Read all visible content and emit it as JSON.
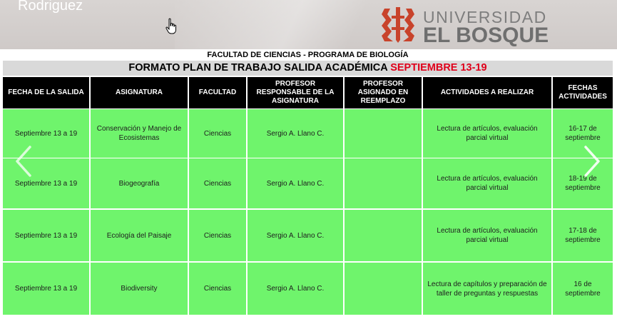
{
  "banner": {
    "user_name": "Rodriguez",
    "logo_line1": "UNIVERSIDAD",
    "logo_line2": "EL BOSQUE"
  },
  "titles": {
    "faculty_program": "FACULTAD DE CIENCIAS - PROGRAMA DE BIOLOGÍA",
    "format_title": "FORMATO PLAN DE TRABAJO SALIDA ACADÉMICA",
    "format_dates": "SEPTIEMBRE 13-19"
  },
  "table": {
    "headers": [
      "FECHA DE LA SALIDA",
      "ASIGNATURA",
      "FACULTAD",
      "PROFESOR RESPONSABLE DE LA ASIGNATURA",
      "PROFESOR ASIGNADO EN REEMPLAZO",
      "ACTIVIDADES A REALIZAR",
      "FECHAS ACTIVIDADES"
    ],
    "rows": [
      [
        "Septiembre 13 a 19",
        "Conservación y Manejo de Ecosistemas",
        "Ciencias",
        "Sergio A. Llano C.",
        "",
        "Lectura de artículos, evaluación parcial virtual",
        "16-17 de septiembre"
      ],
      [
        "Septiembre 13 a 19",
        "Biogeografía",
        "Ciencias",
        "Sergio A. Llano C.",
        "",
        "Lectura de artículos, evaluación parcial virtual",
        "18-19 de septiembre"
      ],
      [
        "Septiembre 13 a 19",
        "Ecología del Paisaje",
        "Ciencias",
        "Sergio A. Llano C.",
        "",
        "Lectura de artículos, evaluación parcial virtual",
        "17-18 de septiembre"
      ],
      [
        "Septiembre 13 a 19",
        "Biodiversity",
        "Ciencias",
        "Sergio A. Llano C.",
        "",
        "Lectura de capítulos y preparación de taller de preguntas y respuestas",
        "16 de septiembre"
      ]
    ]
  },
  "colors": {
    "header_bg": "#000000",
    "row_bg": "#6ff46c",
    "accent_red": "#e0001b",
    "logo_red": "#c8432b"
  },
  "icons": [
    "hand-cursor-icon",
    "university-crest-icon",
    "chevron-left-icon",
    "chevron-right-icon"
  ]
}
